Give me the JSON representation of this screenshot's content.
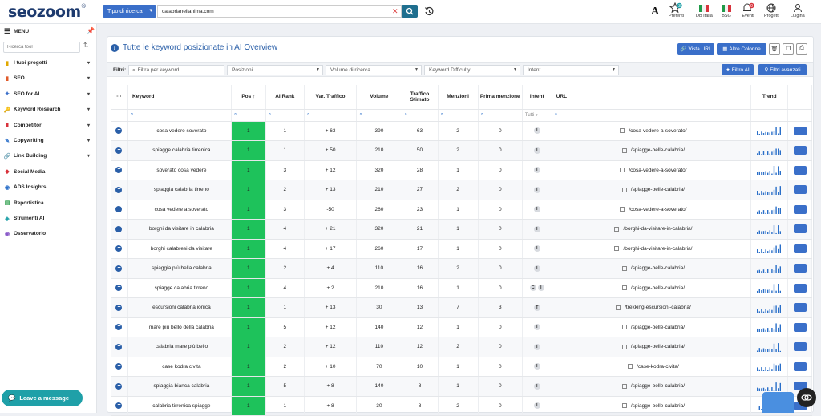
{
  "app": {
    "logo": "seozoom",
    "logo_reg": "®"
  },
  "topbar": {
    "search_type_label": "Tipo di ricerca",
    "search_value": "calabrianellanima.com",
    "items": [
      {
        "label": "Preferiti",
        "badge": "3"
      },
      {
        "label": "DB Italia"
      },
      {
        "label": "BSG"
      },
      {
        "label": "Eventi",
        "badge": "0"
      },
      {
        "label": "Progetti"
      },
      {
        "label": "Luigina"
      }
    ]
  },
  "sidebar": {
    "menu_label": "MENU",
    "tool_search_placeholder": "Ricerca tool",
    "items": [
      {
        "label": "I tuoi progetti",
        "expandable": true
      },
      {
        "label": "SEO",
        "expandable": true
      },
      {
        "label": "SEO for AI",
        "expandable": true
      },
      {
        "label": "Keyword Research",
        "expandable": true
      },
      {
        "label": "Competitor",
        "expandable": true
      },
      {
        "label": "Copywriting",
        "expandable": true
      },
      {
        "label": "Link Building",
        "expandable": true
      },
      {
        "label": "Social Media",
        "expandable": false
      },
      {
        "label": "ADS Insights",
        "expandable": false
      },
      {
        "label": "Reportistica",
        "expandable": false
      },
      {
        "label": "Strumenti AI",
        "expandable": false
      },
      {
        "label": "Osservatorio",
        "expandable": false
      }
    ],
    "leave_message": "Leave a message"
  },
  "panel": {
    "title": "Tutte le keyword posizionate in AI Overview",
    "btn_vista_url": "Vista URL",
    "btn_altre_colonne": "Altre Colonne",
    "filters_label": "Filtri:",
    "filter_keyword_placeholder": "Filtra per keyword",
    "filter_selects": [
      "Posizioni",
      "Volume di ricerca",
      "Keyword Difficulty",
      "Intent"
    ],
    "btn_filtro_ai": "Filtro AI",
    "btn_filtri_avanzati": "Filtri avanzati"
  },
  "table": {
    "headers": {
      "menu": "···",
      "keyword": "Keyword",
      "pos": "Pos",
      "pos_sort": "↑",
      "ai_rank": "AI Rank",
      "var_traffico": "Var. Traffico",
      "volume": "Volume",
      "traffico_stimato": "Traffico Stimato",
      "menzioni": "Menzioni",
      "prima_menzione": "Prima menzione",
      "intent": "Intent",
      "url": "URL",
      "trend": "Trend"
    },
    "intent_filter_value": "Tutti",
    "rows": [
      {
        "keyword": "cosa vedere soverato",
        "pos": "1",
        "ai_rank": "1",
        "var": "+ 63",
        "volume": "390",
        "traffico": "63",
        "menzioni": "2",
        "prima": "0",
        "intent": [
          "I"
        ],
        "url": "/cosa-vedere-a-soverato/"
      },
      {
        "keyword": "spiagge calabria tirrenica",
        "pos": "1",
        "ai_rank": "1",
        "var": "+ 50",
        "volume": "210",
        "traffico": "50",
        "menzioni": "2",
        "prima": "0",
        "intent": [
          "I"
        ],
        "url": "/spiagge-belle-calabria/"
      },
      {
        "keyword": "soverato cosa vedere",
        "pos": "1",
        "ai_rank": "3",
        "var": "+ 12",
        "volume": "320",
        "traffico": "28",
        "menzioni": "1",
        "prima": "0",
        "intent": [
          "I"
        ],
        "url": "/cosa-vedere-a-soverato/"
      },
      {
        "keyword": "spiaggia calabria tirreno",
        "pos": "1",
        "ai_rank": "2",
        "var": "+ 13",
        "volume": "210",
        "traffico": "27",
        "menzioni": "2",
        "prima": "0",
        "intent": [
          "I"
        ],
        "url": "/spiagge-belle-calabria/"
      },
      {
        "keyword": "cosa vedere a soverato",
        "pos": "1",
        "ai_rank": "3",
        "var": "-50",
        "volume": "260",
        "traffico": "23",
        "menzioni": "1",
        "prima": "0",
        "intent": [
          "I"
        ],
        "url": "/cosa-vedere-a-soverato/"
      },
      {
        "keyword": "borghi da visitare in calabria",
        "pos": "1",
        "ai_rank": "4",
        "var": "+ 21",
        "volume": "320",
        "traffico": "21",
        "menzioni": "1",
        "prima": "0",
        "intent": [
          "I"
        ],
        "url": "/borghi-da-visitare-in-calabria/"
      },
      {
        "keyword": "borghi calabresi da visitare",
        "pos": "1",
        "ai_rank": "4",
        "var": "+ 17",
        "volume": "260",
        "traffico": "17",
        "menzioni": "1",
        "prima": "0",
        "intent": [
          "I"
        ],
        "url": "/borghi-da-visitare-in-calabria/"
      },
      {
        "keyword": "spiaggia più bella calabria",
        "pos": "1",
        "ai_rank": "2",
        "var": "+ 4",
        "volume": "110",
        "traffico": "16",
        "menzioni": "2",
        "prima": "0",
        "intent": [
          "I"
        ],
        "url": "/spiagge-belle-calabria/"
      },
      {
        "keyword": "spiagge calabria tirreno",
        "pos": "1",
        "ai_rank": "4",
        "var": "+ 2",
        "volume": "210",
        "traffico": "16",
        "menzioni": "1",
        "prima": "0",
        "intent": [
          "C",
          "I"
        ],
        "url": "/spiagge-belle-calabria/"
      },
      {
        "keyword": "escursioni calabria ionica",
        "pos": "1",
        "ai_rank": "1",
        "var": "+ 13",
        "volume": "30",
        "traffico": "13",
        "menzioni": "7",
        "prima": "3",
        "intent": [
          "T"
        ],
        "url": "/trekking-escursioni-calabria/"
      },
      {
        "keyword": "mare più bello della calabria",
        "pos": "1",
        "ai_rank": "5",
        "var": "+ 12",
        "volume": "140",
        "traffico": "12",
        "menzioni": "1",
        "prima": "0",
        "intent": [
          "I"
        ],
        "url": "/spiagge-belle-calabria/"
      },
      {
        "keyword": "calabria mare più bello",
        "pos": "1",
        "ai_rank": "2",
        "var": "+ 12",
        "volume": "110",
        "traffico": "12",
        "menzioni": "2",
        "prima": "0",
        "intent": [
          "I"
        ],
        "url": "/spiagge-belle-calabria/"
      },
      {
        "keyword": "case kodra civita",
        "pos": "1",
        "ai_rank": "2",
        "var": "+ 10",
        "volume": "70",
        "traffico": "10",
        "menzioni": "1",
        "prima": "0",
        "intent": [
          "I"
        ],
        "url": "/case-kodra-civita/"
      },
      {
        "keyword": "spiaggia bianca calabria",
        "pos": "1",
        "ai_rank": "5",
        "var": "+ 8",
        "volume": "140",
        "traffico": "8",
        "menzioni": "1",
        "prima": "0",
        "intent": [
          "I"
        ],
        "url": "/spiagge-belle-calabria/"
      },
      {
        "keyword": "calabria tirrenica spiagge",
        "pos": "1",
        "ai_rank": "1",
        "var": "+ 8",
        "volume": "30",
        "traffico": "8",
        "menzioni": "2",
        "prima": "0",
        "intent": [
          "I"
        ],
        "url": "/spiagge-belle-calabria/"
      }
    ]
  },
  "colors": {
    "accent": "#3a6fc9",
    "pos_green": "#1ec25b",
    "link": "#2a6fc9",
    "teal": "#1fa0a8"
  }
}
